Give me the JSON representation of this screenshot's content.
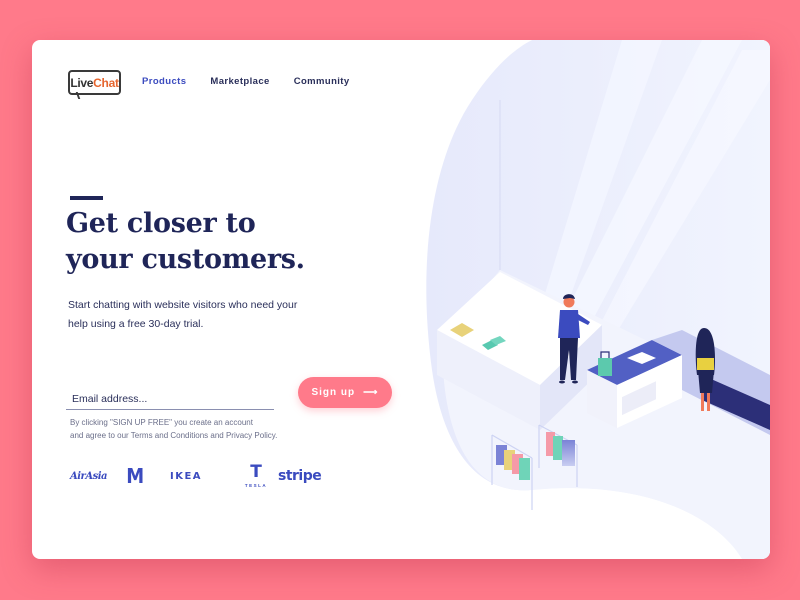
{
  "brand": {
    "logo_part1": "Live",
    "logo_part2": "Chat"
  },
  "nav": {
    "items": [
      {
        "label": "Products",
        "active": true
      },
      {
        "label": "Marketplace",
        "active": false
      },
      {
        "label": "Community",
        "active": false
      }
    ]
  },
  "hero": {
    "headline_line1": "Get closer to",
    "headline_line2": "your customers.",
    "subtext": "Start chatting with website visitors who need your help using a free 30-day trial."
  },
  "signup_form": {
    "email_placeholder": "Email address...",
    "email_value": "",
    "button_label": "Sign up",
    "button_arrow": "⟶",
    "legal_line1": "By clicking \"SIGN UP FREE\" you create an account",
    "legal_line2": "and agree to our Terms and Conditions and Privacy Policy."
  },
  "client_logos": [
    {
      "name": "AirAsia",
      "text": "AirAsia"
    },
    {
      "name": "McDonald's",
      "text": "M"
    },
    {
      "name": "IKEA",
      "text": "IKEA"
    },
    {
      "name": "Tesla",
      "text": "T",
      "wordmark": "TESLA"
    },
    {
      "name": "Stripe",
      "text": "stripe"
    }
  ],
  "illustration": {
    "description": "Isometric store scene with shopper, cashier at counter, clothing racks",
    "icon": "store-scene-illustration"
  },
  "colors": {
    "background": "#ff7a8a",
    "primary_navy": "#1f2558",
    "accent_blue": "#3b4bbf",
    "button": "#ff7a8a",
    "logo_orange": "#e5652e"
  }
}
